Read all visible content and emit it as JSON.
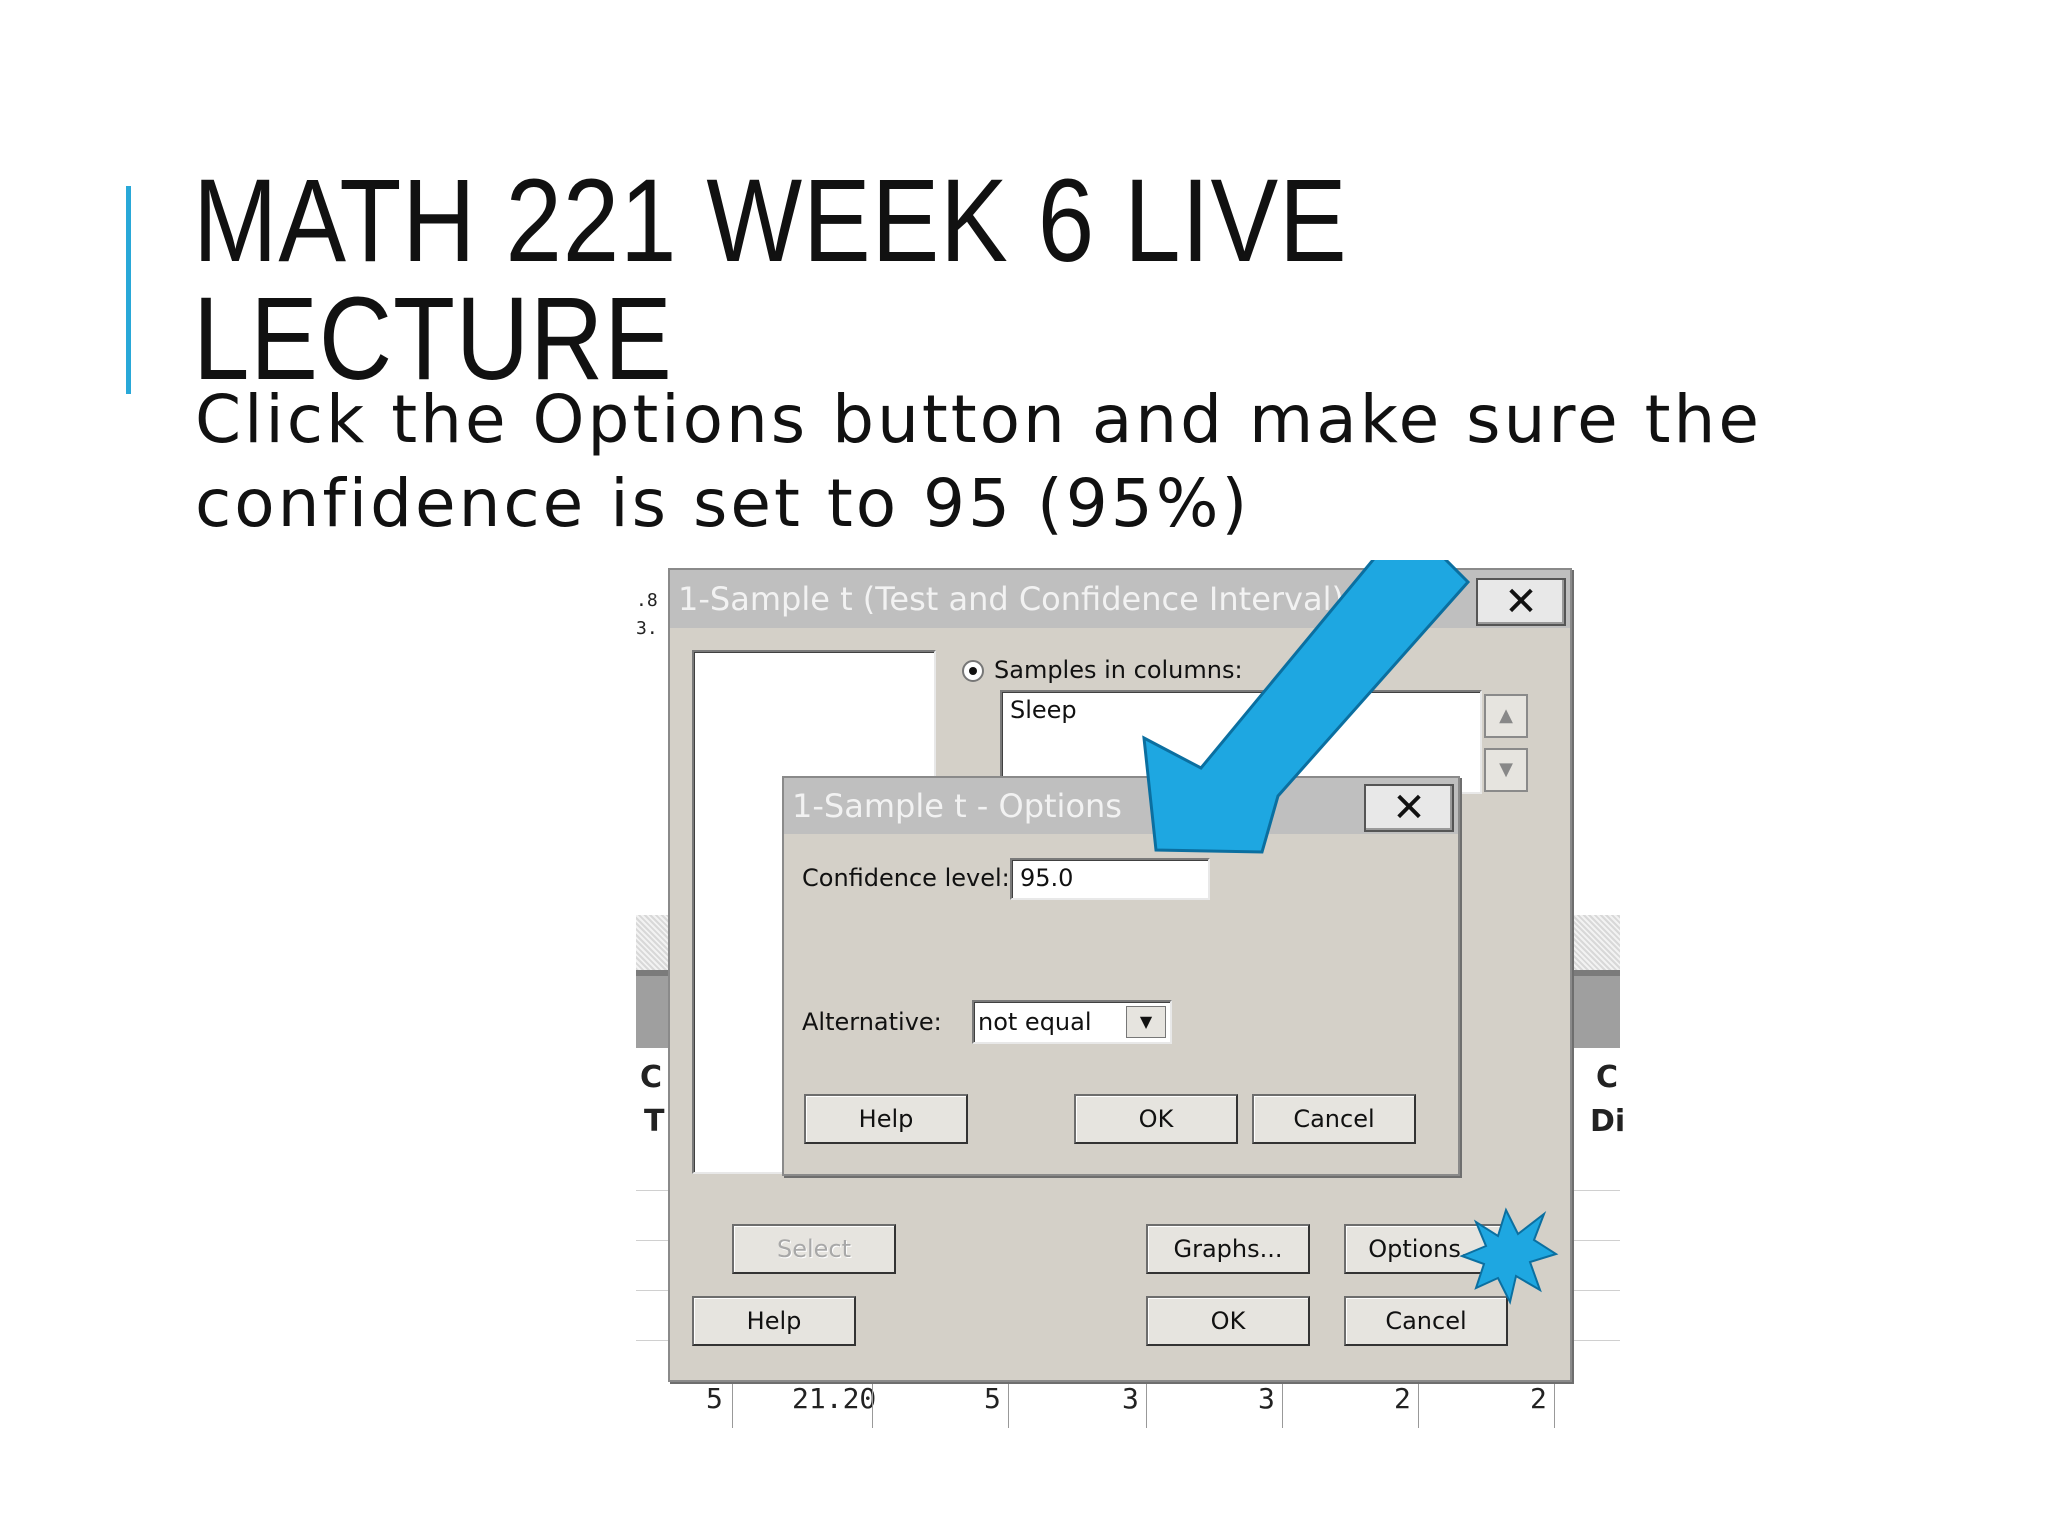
{
  "slide": {
    "title": "MATH 221 WEEK 6 LIVE LECTURE",
    "body": "Click the Options button and make sure the confidence is set to 95 (95%)"
  },
  "background_table": {
    "frag_top1": ".8",
    "frag_top2": "3.",
    "header_left_1": "C",
    "header_left_2": "T",
    "header_right_1": "C",
    "header_right_2": "Di",
    "row_values": [
      "5",
      "21.20",
      "5",
      "3",
      "3",
      "2",
      "2"
    ]
  },
  "main_dialog": {
    "title": "1-Sample t (Test and Confidence Interval)",
    "close_glyph": "✕",
    "radio_label": "Samples in columns:",
    "samples_value": "Sleep",
    "scroll_up": "▲",
    "scroll_down": "▼",
    "select_label": "Select",
    "graphs_label": "Graphs...",
    "options_label": "Options...",
    "help_label": "Help",
    "ok_label": "OK",
    "cancel_label": "Cancel"
  },
  "options_dialog": {
    "title": "1-Sample t - Options",
    "close_glyph": "✕",
    "confidence_label": "Confidence level:",
    "confidence_value": "95.0",
    "alternative_label": "Alternative:",
    "alternative_value": "not equal",
    "dropdown_glyph": "▼",
    "help_label": "Help",
    "ok_label": "OK",
    "cancel_label": "Cancel"
  },
  "colors": {
    "accent": "#29a8d8",
    "highlight_arrow": "#1ea7e1",
    "dialog_bg": "#d4d0c8",
    "title_bar": "#bfbfbf"
  },
  "annotations": {
    "arrow_icon": "arrow-pointing-to-confidence-field",
    "burst_icon": "starburst-highlighting-options-button"
  }
}
